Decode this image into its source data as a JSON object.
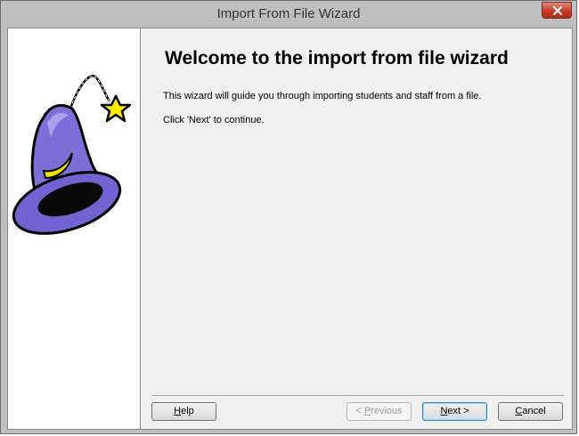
{
  "window": {
    "title": "Import From File Wizard",
    "close_icon": "close-x-icon"
  },
  "side_panel": {
    "image": "wizard-hat-icon"
  },
  "content": {
    "heading": "Welcome to the import from file wizard",
    "intro": "This wizard will guide you through importing students and staff from a file.",
    "continue_hint": "Click 'Next' to continue."
  },
  "buttons": {
    "help": {
      "label": "Help",
      "mnemonic": "H",
      "rest": "elp"
    },
    "previous": {
      "prefix": "< ",
      "mnemonic": "P",
      "rest": "revious",
      "enabled": false
    },
    "next": {
      "mnemonic": "N",
      "rest": "ext >",
      "default": true
    },
    "cancel": {
      "mnemonic": "C",
      "rest": "ancel"
    }
  }
}
